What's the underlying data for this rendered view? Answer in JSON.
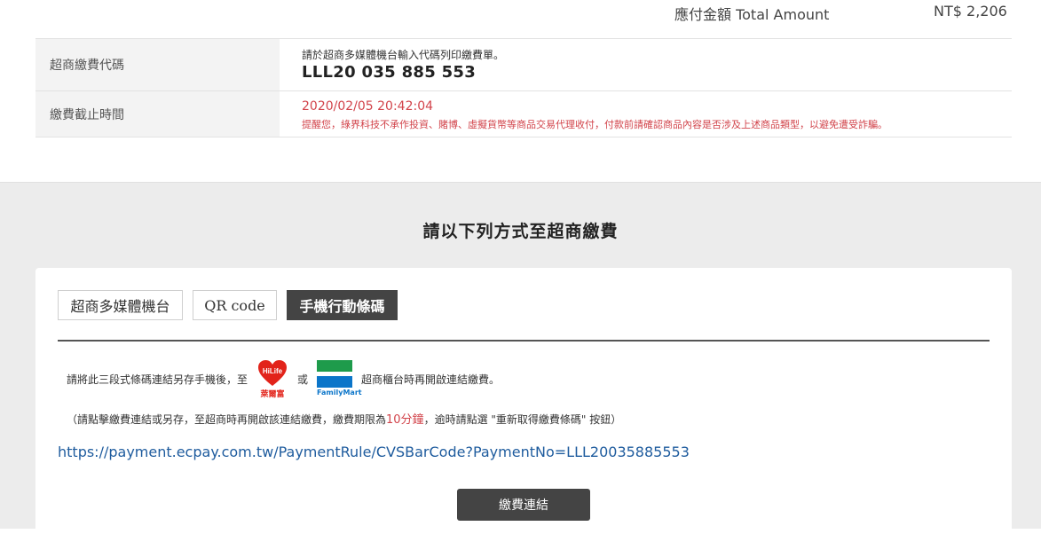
{
  "summary": {
    "total_label": "應付金額 Total Amount",
    "total_value": "NT$ 2,206"
  },
  "info": {
    "code_label": "超商繳費代碼",
    "code_note": "請於超商多媒體機台輸入代碼列印繳費單。",
    "code_value": "LLL20 035 885 553",
    "deadline_label": "繳費截止時間",
    "deadline_value": "2020/02/05 20:42:04",
    "warning": "提醒您，綠界科技不承作投資、賭博、虛擬貨幣等商品交易代理收付，付款前請確認商品內容是否涉及上述商品類型，以避免遭受詐騙。"
  },
  "section": {
    "title": "請以下列方式至超商繳費"
  },
  "tabs": [
    {
      "label": "超商多媒體機台",
      "active": false
    },
    {
      "label": "QR code",
      "active": false
    },
    {
      "label": "手機行動條碼",
      "active": true
    }
  ],
  "mobile": {
    "instruction_prefix": "請將此三段式條碼連結另存手機後，至",
    "instruction_or": "或",
    "instruction_suffix": "超商櫃台時再開啟連結繳費。",
    "note_prefix": "（請點擊繳費連結或另存，至超商時再開啟該連結繳費，繳費期限為",
    "note_highlight": "10分鐘",
    "note_suffix": "，逾時請點選 \"重新取得繳費條碼\" 按鈕）",
    "url": "https://payment.ecpay.com.tw/PaymentRule/CVSBarCode?PaymentNo=LLL20035885553",
    "button_label": "繳費連結",
    "logo_hilife_text": "HiLife",
    "logo_hilife_name": "萊爾富",
    "logo_fm_name": "FamilyMart"
  },
  "colors": {
    "accent_red": "#d2444b",
    "link_blue": "#1f5c9e",
    "dark_button": "#444444"
  }
}
